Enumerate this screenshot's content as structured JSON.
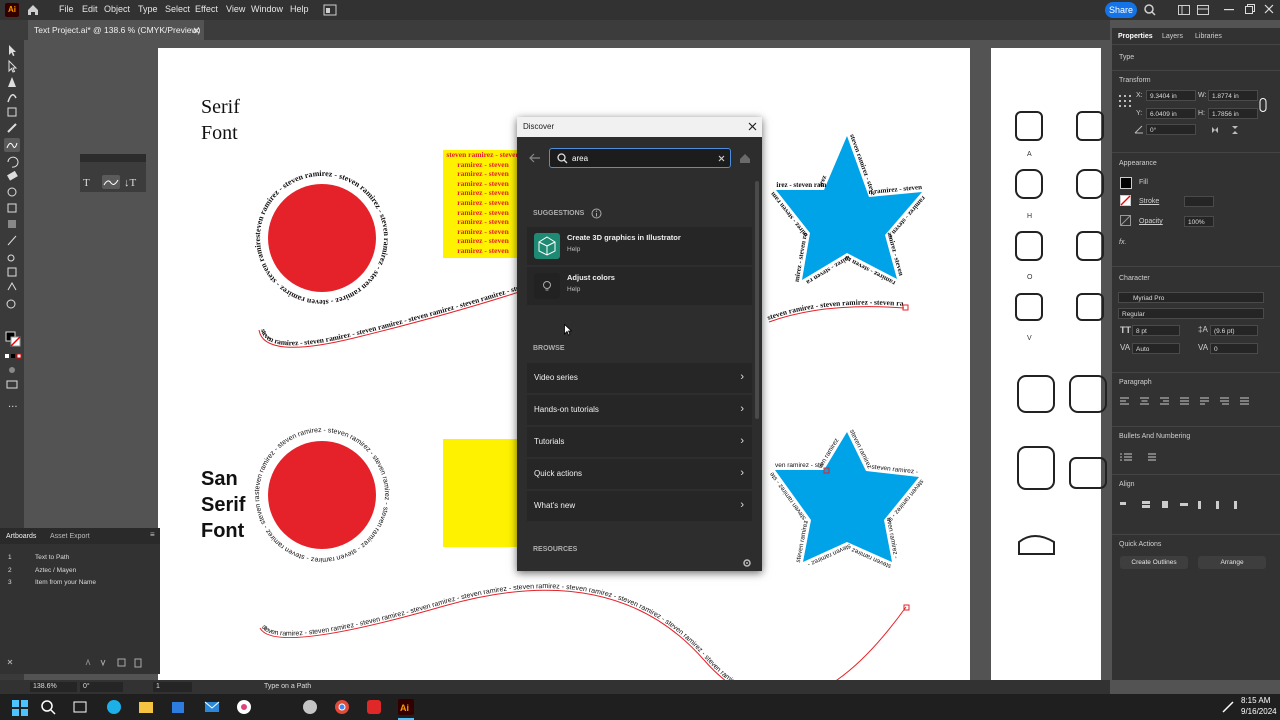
{
  "app": {
    "logo": "Ai"
  },
  "menu": [
    "File",
    "Edit",
    "Object",
    "Type",
    "Select",
    "Effect",
    "View",
    "Window",
    "Help"
  ],
  "share_label": "Share",
  "document_tab": {
    "title": "Text Project.ai* @ 138.6 % (CMYK/Preview)"
  },
  "artboard": {
    "serif_heading_1": "Serif",
    "serif_heading_2": "Font",
    "sans_heading_1": "San",
    "sans_heading_2": "Serif",
    "sans_heading_3": "Font",
    "repeat_text": "steven ramirez - steven ramirez - steven ramirez - steven ramirez - steven ramirez - steven ramirez - steven ramirez - steven ramirez - steven ramirez - steven ramirez",
    "area_text": "steven ramirez - steven ramirez - steven ramirez - steven ramirez - steven ramirez - steven ramirez - steven ramirez - steven ramirez - steven ramirez - steven ramirez - steven ramirez - steven ramirez - steven ramirez - steven ramirez - steven ramirez - steven ramirez - steven ramirez - steven ramirez - steven ramirez - steven ramirez",
    "glyph_labels": [
      "A",
      "H",
      "O",
      "V"
    ]
  },
  "discover": {
    "title": "Discover",
    "search_value": "area",
    "suggestions_label": "SUGGESTIONS",
    "suggestions": [
      {
        "title": "Create 3D graphics in Illustrator",
        "subtitle": "Help"
      },
      {
        "title": "Adjust colors",
        "subtitle": "Help"
      }
    ],
    "browse_label": "BROWSE",
    "browse": [
      "Video series",
      "Hands-on tutorials",
      "Tutorials",
      "Quick actions",
      "What's new"
    ],
    "resources_label": "RESOURCES"
  },
  "panel": {
    "tabs": [
      "Properties",
      "Layers",
      "Libraries"
    ],
    "type_label": "Type",
    "transform_label": "Transform",
    "x_label": "X:",
    "x": "9.3404 in",
    "y_label": "Y:",
    "y": "6.0409 in",
    "w_label": "W:",
    "w": "1.8774 in",
    "h_label": "H:",
    "h": "1.7856 in",
    "angle": "0°",
    "appearance_label": "Appearance",
    "fill_label": "Fill",
    "stroke_label": "Stroke",
    "opacity_label": "Opacity",
    "opacity": "100%",
    "fx_label": "fx.",
    "character_label": "Character",
    "font_family": "Myriad Pro",
    "font_style": "Regular",
    "font_size": "8 pt",
    "leading": "(9.6 pt)",
    "kerning": "Auto",
    "tracking": "0",
    "paragraph_label": "Paragraph",
    "bullets_label": "Bullets And Numbering",
    "align_label": "Align",
    "quick_actions_label": "Quick Actions",
    "create_outlines": "Create Outlines",
    "arrange": "Arrange"
  },
  "artboards_panel": {
    "tabs": [
      "Artboards",
      "Asset Export"
    ],
    "rows": [
      {
        "num": "1",
        "name": "Text to Path"
      },
      {
        "num": "2",
        "name": "Aztec / Mayen"
      },
      {
        "num": "3",
        "name": "Item from your Name"
      }
    ]
  },
  "status": {
    "zoom": "138.6%",
    "rotation": "0°",
    "artboard": "1",
    "tool": "Type on a Path"
  },
  "taskbar": {
    "time": "8:15 AM",
    "date": "9/16/2024"
  },
  "colors": {
    "red": "#e52229",
    "blue": "#00a2e8",
    "yellow": "#fff200",
    "accent": "#1473e6"
  }
}
